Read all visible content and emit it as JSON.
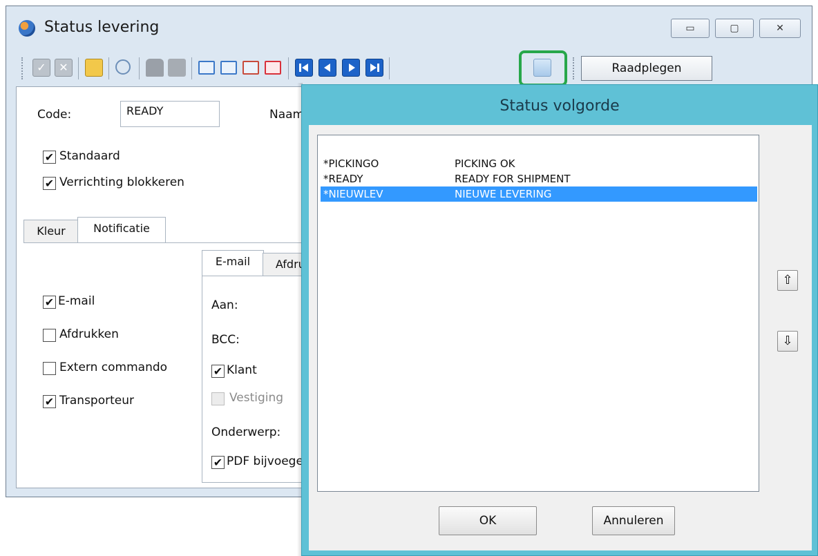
{
  "window": {
    "title": "Status levering",
    "min_glyph": "▭",
    "max_glyph": "▢",
    "close_glyph": "✕"
  },
  "toolbar": {
    "raadplegen_label": "Raadplegen"
  },
  "form": {
    "code_label": "Code:",
    "code_value": "READY",
    "naam_label": "Naam",
    "standaard_label": "Standaard",
    "verrichting_label": "Verrichting blokkeren",
    "tabs": {
      "kleur": "Kleur",
      "notificatie": "Notificatie"
    },
    "notify": {
      "email": "E-mail",
      "afdrukken": "Afdrukken",
      "extern": "Extern commando",
      "transporteur": "Transporteur"
    },
    "subtabs": {
      "email": "E-mail",
      "afdruk": "Afdruk"
    },
    "aan_label": "Aan:",
    "bcc_label": "BCC:",
    "klant_label": "Klant",
    "vestiging_label": "Vestiging",
    "onderwerp_label": "Onderwerp:",
    "pdf_label": "PDF bijvoege"
  },
  "dialog": {
    "title": "Status volgorde",
    "rows": [
      {
        "code": "*PICKINGO",
        "name": "PICKING OK",
        "selected": false
      },
      {
        "code": "*READY",
        "name": "READY FOR SHIPMENT",
        "selected": false
      },
      {
        "code": "*NIEUWLEV",
        "name": "NIEUWE LEVERING",
        "selected": true
      }
    ],
    "ok_label": "OK",
    "cancel_label": "Annuleren",
    "up_glyph": "⇧",
    "down_glyph": "⇩"
  },
  "checkmark": "✔",
  "colors": {
    "accent": "#3399ff",
    "dialog_frame": "#5fc1d6",
    "highlight": "#27a74a"
  }
}
